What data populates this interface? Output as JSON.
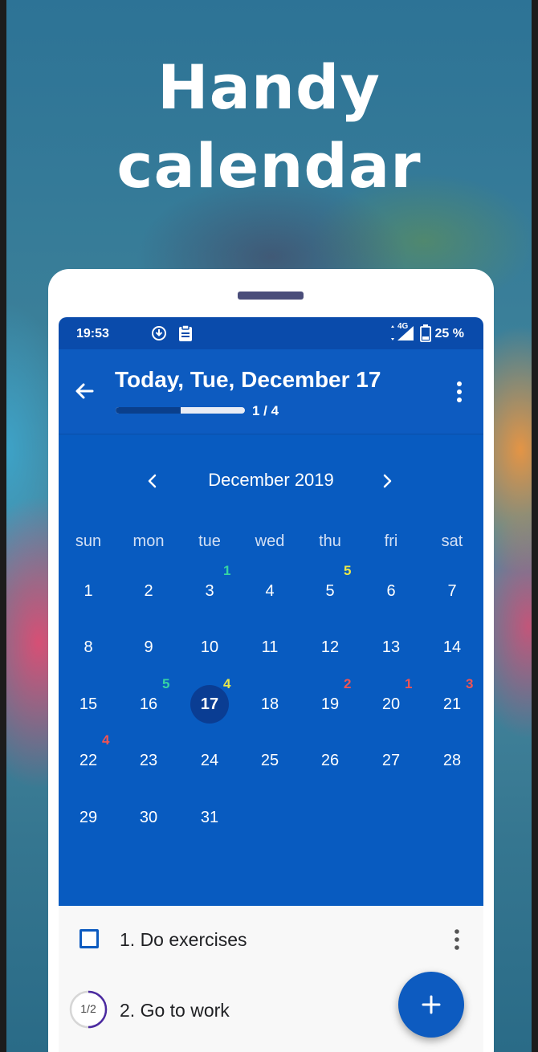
{
  "promo": {
    "headline_line1": "Handy",
    "headline_line2": "calendar"
  },
  "statusbar": {
    "time": "19:53",
    "network": "4G",
    "battery": "25 %"
  },
  "appbar": {
    "title": "Today, Tue, December 17",
    "progress_text": "1 / 4",
    "progress_fraction": 0.5
  },
  "calendar": {
    "month_label": "December 2019",
    "weekdays": [
      "sun",
      "mon",
      "tue",
      "wed",
      "thu",
      "fri",
      "sat"
    ],
    "today": 17,
    "days": [
      "1",
      "2",
      "3",
      "4",
      "5",
      "6",
      "7",
      "8",
      "9",
      "10",
      "11",
      "12",
      "13",
      "14",
      "15",
      "16",
      "17",
      "18",
      "19",
      "20",
      "21",
      "22",
      "23",
      "24",
      "25",
      "26",
      "27",
      "28",
      "29",
      "30",
      "31"
    ],
    "badges": [
      {
        "day": "3",
        "count": "1",
        "color": "#35d4a3"
      },
      {
        "day": "5",
        "count": "5",
        "color": "#e8e84a"
      },
      {
        "day": "16",
        "count": "5",
        "color": "#35d4a3"
      },
      {
        "day": "17",
        "count": "4",
        "color": "#e8e84a"
      },
      {
        "day": "19",
        "count": "2",
        "color": "#f05454"
      },
      {
        "day": "20",
        "count": "1",
        "color": "#f05454"
      },
      {
        "day": "21",
        "count": "3",
        "color": "#f05454"
      },
      {
        "day": "22",
        "count": "4",
        "color": "#f05454"
      }
    ]
  },
  "tasks": [
    {
      "label": "1. Do exercises",
      "state": "unchecked"
    },
    {
      "label": "2. Go to work",
      "progress": "1/2"
    }
  ],
  "colors": {
    "primary": "#0d5bc0",
    "statusbar": "#0a4bab",
    "today_circle": "#0a3d93"
  },
  "icons": {
    "back": "arrow-left-icon",
    "more": "more-vertical-icon",
    "prev": "chevron-left-icon",
    "next": "chevron-right-icon",
    "fab": "plus-icon"
  }
}
